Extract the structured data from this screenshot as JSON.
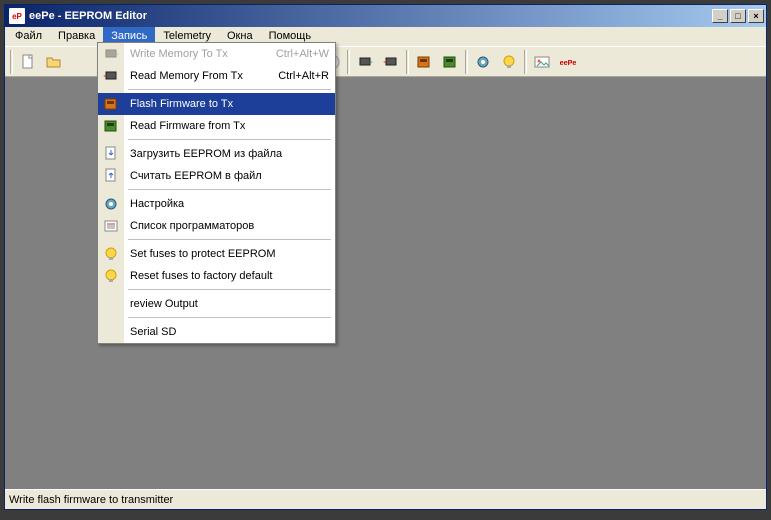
{
  "title": "eePe - EEPROM Editor",
  "menus": [
    "Файл",
    "Правка",
    "Запись",
    "Telemetry",
    "Окна",
    "Помощь"
  ],
  "open_menu_index": 2,
  "dropdown": {
    "items": [
      {
        "label": "Write Memory To Tx",
        "shortcut": "Ctrl+Alt+W",
        "icon": "chip-write",
        "disabled": true
      },
      {
        "label": "Read Memory From Tx",
        "shortcut": "Ctrl+Alt+R",
        "icon": "chip-read"
      },
      {
        "sep": true
      },
      {
        "label": "Flash Firmware to Tx",
        "icon": "box-orange",
        "highlight": true
      },
      {
        "label": "Read Firmware from Tx",
        "icon": "box-green"
      },
      {
        "sep": true
      },
      {
        "label": "Загрузить EEPROM из файла",
        "icon": "doc-down"
      },
      {
        "label": "Считать EEPROM в файл",
        "icon": "doc-up"
      },
      {
        "sep": true
      },
      {
        "label": "Настройка",
        "icon": "gear"
      },
      {
        "label": "Список программаторов",
        "icon": "list"
      },
      {
        "sep": true
      },
      {
        "label": "Set fuses to protect EEPROM",
        "icon": "bulb"
      },
      {
        "label": "Reset fuses to factory default",
        "icon": "bulb"
      },
      {
        "sep": true
      },
      {
        "label": "review Output"
      },
      {
        "sep": true
      },
      {
        "label": "Serial SD"
      }
    ]
  },
  "status": "Write flash firmware to transmitter",
  "colors": {
    "highlight": "#1d3f9a",
    "titlebar_dark": "#0a246a",
    "titlebar_light": "#a6caf0",
    "client_bg": "#808080"
  }
}
